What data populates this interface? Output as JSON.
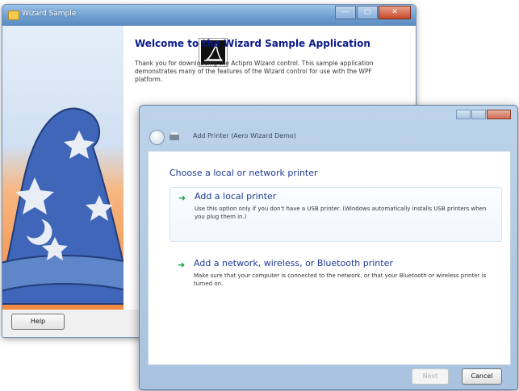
{
  "back_window": {
    "title": "Wizard Sample",
    "caption_buttons": {
      "minimize": "—",
      "maximize": "▢",
      "close": "✕"
    },
    "heading": "Welcome to the Wizard Sample Application",
    "body": "Thank you for downloading the Actipro Wizard control. This sample application demonstrates many of the features of the Wizard control for use with the WPF platform.",
    "help_label": "Help"
  },
  "front_window": {
    "title": "Add Printer (Aero Wizard Demo)",
    "heading": "Choose a local or network printer",
    "options": [
      {
        "arrow": "➜",
        "title": "Add a local printer",
        "description": "Use this option only if you don't have a USB printer. (Windows automatically installs USB printers when you plug them in.)"
      },
      {
        "arrow": "➜",
        "title": "Add a network, wireless, or Bluetooth printer",
        "description": "Make sure that your computer is connected to the network, or that your Bluetooth or wireless printer is turned on."
      }
    ],
    "next_label": "Next",
    "cancel_label": "Cancel"
  },
  "colors": {
    "title_blue": "#0a1a8a",
    "link_blue": "#1f3a93",
    "arrow_green": "#1e9a4a"
  }
}
